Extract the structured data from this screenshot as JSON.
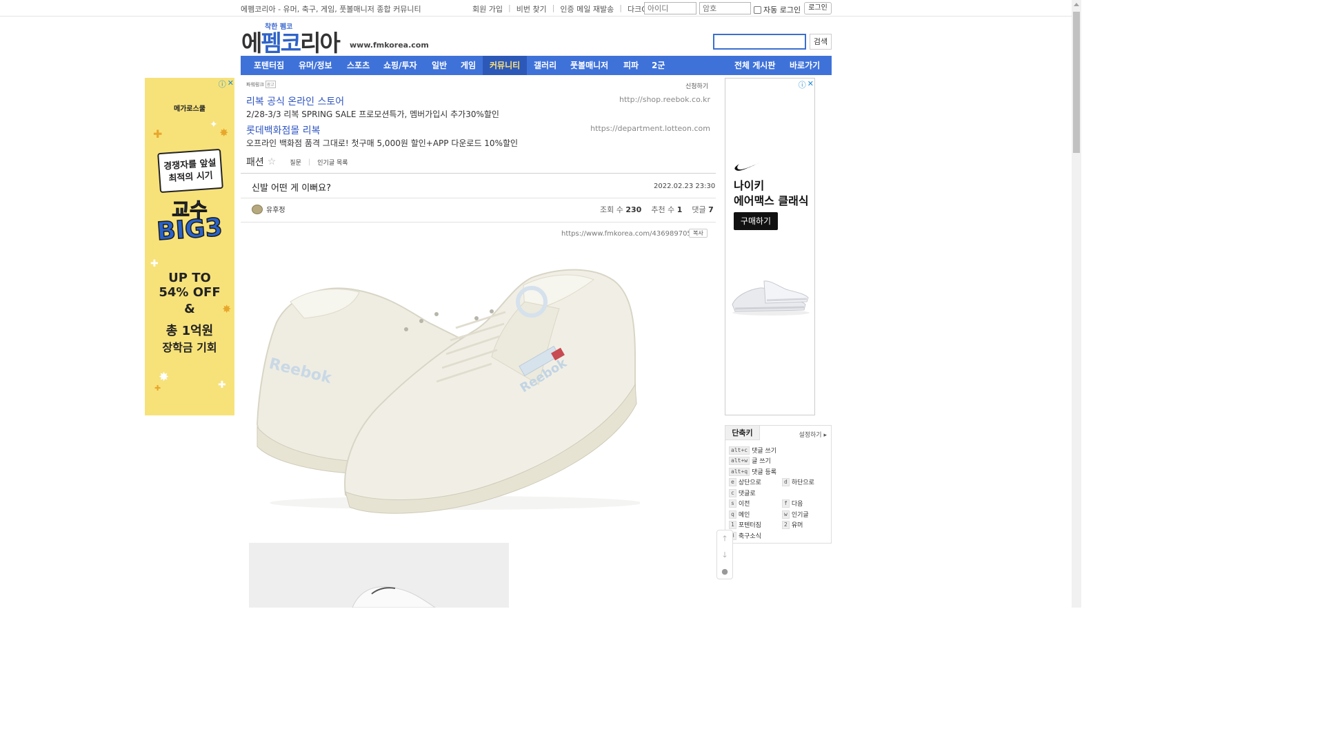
{
  "topbar": {
    "site_description": "에펨코리아 - 유머, 축구, 게임, 풋볼매니저 종합 커뮤니티",
    "links": [
      "회원 가입",
      "비번 찾기",
      "인증 메일 재발송",
      "다크OFF"
    ],
    "id_placeholder": "아이디",
    "pw_placeholder": "암호",
    "auto_login_label": "자동 로그인",
    "login_button": "로그인"
  },
  "header": {
    "logo_sub": "착한 펨코",
    "logo_main_1": "에",
    "logo_main_2": "펨코",
    "logo_main_3": "리아",
    "site_url": "www.fmkorea.com",
    "search_button": "검색"
  },
  "nav": {
    "items": [
      "포텐터짐",
      "유머/정보",
      "스포츠",
      "쇼핑/투자",
      "일반",
      "게임",
      "커뮤니티",
      "갤러리",
      "풋볼매니저",
      "피파",
      "2군"
    ],
    "active": "커뮤니티",
    "right_items": [
      "전체 게시판",
      "바로가기"
    ]
  },
  "left_ad": {
    "brand": "메가로스쿨",
    "bubble_line1": "경쟁자를 앞설",
    "bubble_line2": "최적의 시기",
    "headline1": "교수",
    "headline2": "BIG3",
    "offer1": "UP TO",
    "offer2": "54% OFF",
    "ampersand": "&",
    "scholarship1": "총 1억원",
    "scholarship2": "장학금 기회"
  },
  "right_ad": {
    "title1": "나이키",
    "title2": "에어맥스 클래식",
    "button": "구매하기"
  },
  "powerlink": {
    "label": "파워링크",
    "badge": "광고",
    "apply": "신청하기",
    "ads": [
      {
        "title": "리복 공식 온라인 스토어",
        "desc": "2/28-3/3 리복 SPRING SALE 프로모션특가, 멤버가입시 추가30%할인",
        "url": "http://shop.reebok.co.kr"
      },
      {
        "title": "롯데백화점몰 리복",
        "desc": "오프라인 백화점 품격 그대로! 첫구매 5,000원 할인+APP 다운로드 10%할인",
        "url": "https://department.lotteon.com"
      }
    ]
  },
  "board": {
    "name": "패션",
    "sub1": "질문",
    "sub2": "인기글 목록"
  },
  "post": {
    "title": "신발 어떤 게 이뻐요?",
    "date": "2022.02.23 23:30",
    "author": "유후정",
    "views_label": "조회 수",
    "views": "230",
    "recommend_label": "추천 수",
    "recommend": "1",
    "comments_label": "댓글",
    "comments": "7",
    "url": "https://www.fmkorea.com/4369897052",
    "copy_button": "복사"
  },
  "shortcut": {
    "tab": "단축키",
    "settings": "설정하기",
    "items": [
      {
        "key": "alt+c",
        "label": "댓글 쓰기"
      },
      {
        "key": "alt+w",
        "label": "글 쓰기"
      },
      {
        "key": "alt+q",
        "label": "댓글 등록"
      },
      {
        "key": "e",
        "label": "상단으로"
      },
      {
        "key": "d",
        "label": "하단으로"
      },
      {
        "key": "c",
        "label": "댓글로"
      },
      {
        "key": "s",
        "label": "이전"
      },
      {
        "key": "f",
        "label": "다음"
      },
      {
        "key": "q",
        "label": "메인"
      },
      {
        "key": "w",
        "label": "인기글"
      },
      {
        "key": "1",
        "label": "포텐터짐"
      },
      {
        "key": "2",
        "label": "유머"
      },
      {
        "key": "3",
        "label": "축구소식"
      }
    ]
  },
  "colors": {
    "nav_bg": "#3f72d9",
    "nav_active_text": "#ffe27a",
    "link_blue": "#2f55c2",
    "ad_yellow": "#f7e27a"
  }
}
